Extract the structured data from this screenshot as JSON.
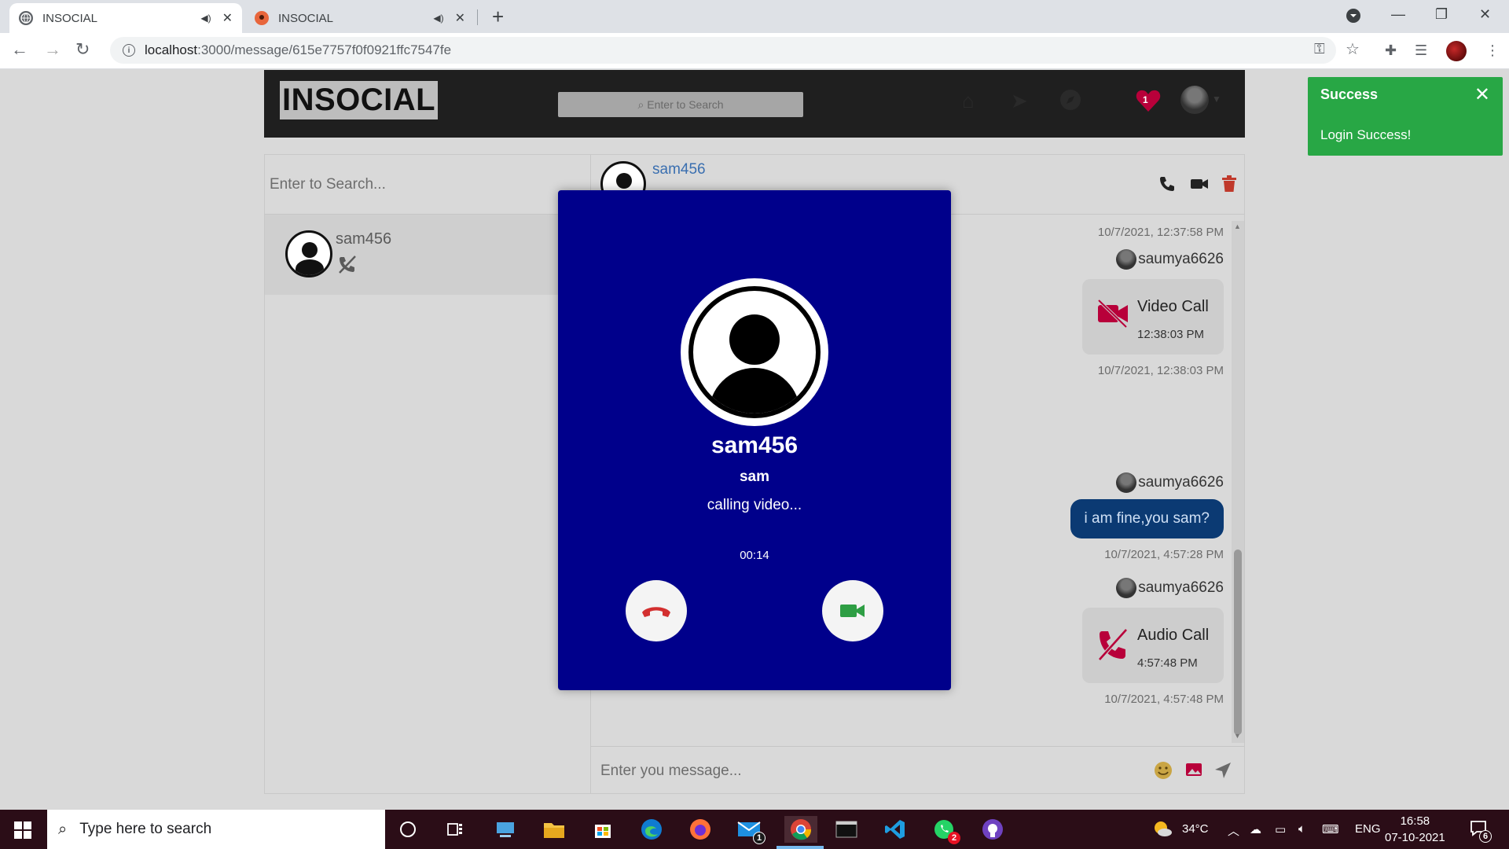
{
  "browser": {
    "tabs": [
      {
        "title": "INSOCIAL",
        "active": true
      },
      {
        "title": "INSOCIAL",
        "active": false
      }
    ],
    "url_host": "localhost",
    "url_rest": ":3000/message/615e7757f0f0921ffc7547fe"
  },
  "app": {
    "logo": "INSOCIAL",
    "nav_search_placeholder": "Enter to Search",
    "notification_count": "1",
    "colors": {
      "navbar": "#1f1f1f",
      "heart": "#b8003a"
    }
  },
  "sidebar": {
    "search_placeholder": "Enter to Search...",
    "conversations": [
      {
        "name": "sam456",
        "icon": "missed-call-icon"
      }
    ]
  },
  "chat": {
    "contact_name": "sam456",
    "messages": {
      "ts1": "10/7/2021, 12:37:58 PM",
      "sender2": "saumya6626",
      "call2_title": "Video Call",
      "call2_time": "12:38:03 PM",
      "ts2": "10/7/2021, 12:38:03 PM",
      "sender3": "saumya6626",
      "text3": "i am fine,you sam?",
      "ts3": "10/7/2021, 4:57:28 PM",
      "sender4": "saumya6626",
      "call4_title": "Audio Call",
      "call4_time": "4:57:48 PM",
      "ts4": "10/7/2021, 4:57:48 PM"
    },
    "composer_placeholder": "Enter you message..."
  },
  "call_modal": {
    "name": "sam456",
    "username": "sam",
    "status": "calling video...",
    "timer": "00:14",
    "colors": {
      "background": "#00008b",
      "decline": "#d32f2f",
      "accept": "#2e9e44"
    }
  },
  "toast": {
    "title": "Success",
    "message": "Login Success!",
    "color": "#28a745"
  },
  "taskbar": {
    "search_placeholder": "Type here to search",
    "mail_badge": "1",
    "whatsapp_badge": "2",
    "weather": "34°C",
    "language": "ENG",
    "time": "16:58",
    "date": "07-10-2021",
    "notifications": "6"
  }
}
